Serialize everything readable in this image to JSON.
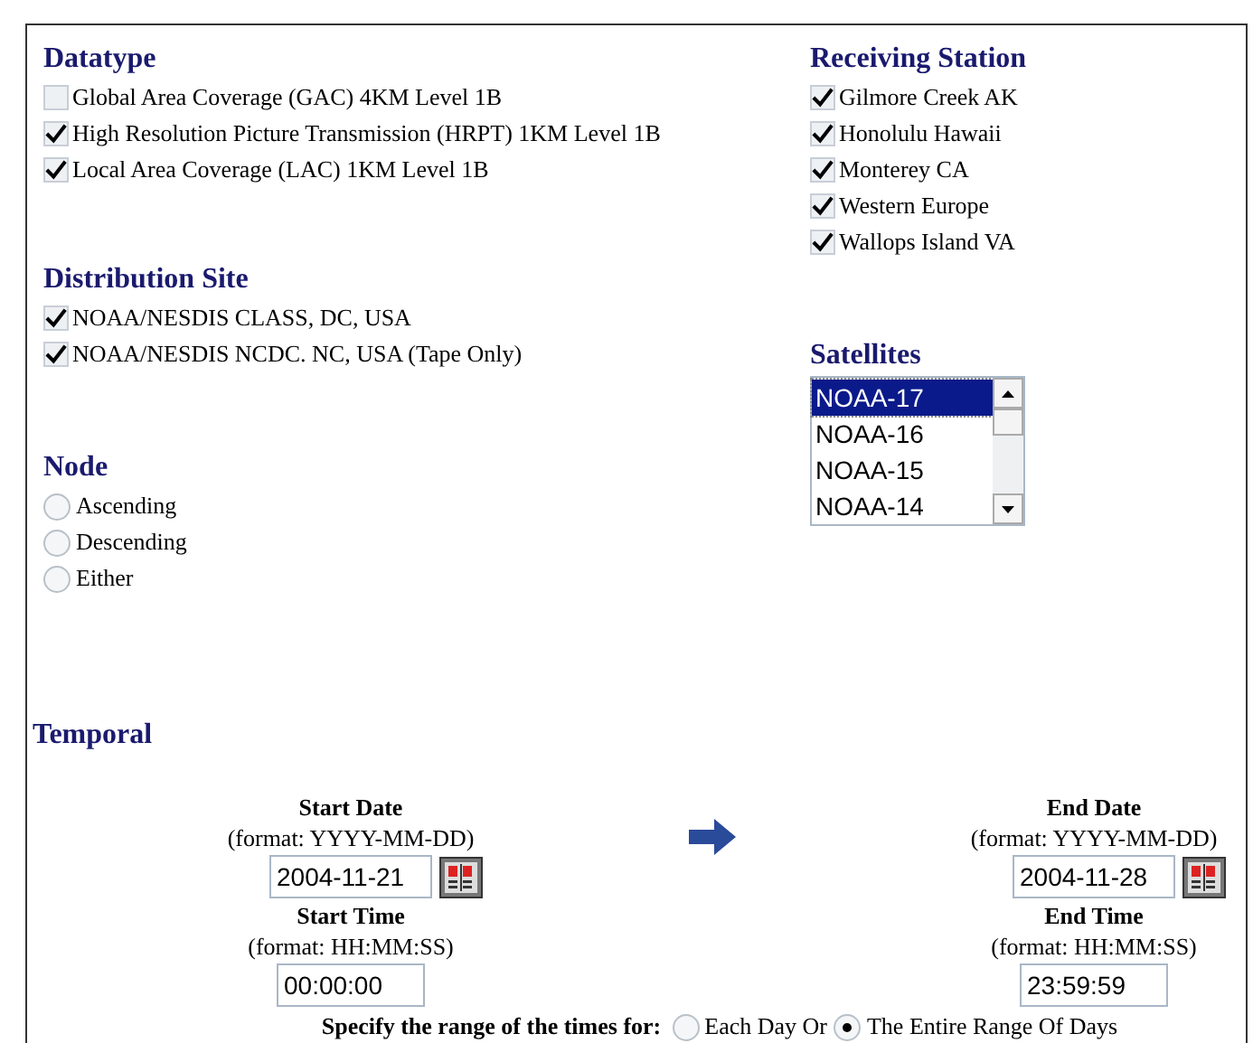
{
  "datatype": {
    "title": "Datatype",
    "options": [
      {
        "label": "Global Area Coverage (GAC) 4KM Level 1B",
        "checked": false
      },
      {
        "label": "High Resolution Picture Transmission (HRPT) 1KM Level 1B",
        "checked": true
      },
      {
        "label": "Local Area Coverage (LAC) 1KM Level 1B",
        "checked": true
      }
    ]
  },
  "distribution_site": {
    "title": "Distribution Site",
    "options": [
      {
        "label": "NOAA/NESDIS CLASS, DC, USA",
        "checked": true
      },
      {
        "label": "NOAA/NESDIS NCDC. NC, USA (Tape Only)",
        "checked": true
      }
    ]
  },
  "node": {
    "title": "Node",
    "options": [
      {
        "label": "Ascending",
        "selected": false
      },
      {
        "label": "Descending",
        "selected": false
      },
      {
        "label": "Either",
        "selected": false
      }
    ]
  },
  "receiving_station": {
    "title": "Receiving Station",
    "options": [
      {
        "label": "Gilmore Creek AK",
        "checked": true
      },
      {
        "label": "Honolulu Hawaii",
        "checked": true
      },
      {
        "label": "Monterey CA",
        "checked": true
      },
      {
        "label": "Western Europe",
        "checked": true
      },
      {
        "label": "Wallops Island VA",
        "checked": true
      }
    ]
  },
  "satellites": {
    "title": "Satellites",
    "items": [
      {
        "label": "NOAA-17",
        "selected": true
      },
      {
        "label": "NOAA-16",
        "selected": false
      },
      {
        "label": "NOAA-15",
        "selected": false
      },
      {
        "label": "NOAA-14",
        "selected": false
      }
    ]
  },
  "temporal": {
    "title": "Temporal",
    "start_date": {
      "label": "Start Date",
      "format": "(format: YYYY-MM-DD)",
      "value": "2004-11-21"
    },
    "start_time": {
      "label": "Start Time",
      "format": "(format: HH:MM:SS)",
      "value": "00:00:00"
    },
    "end_date": {
      "label": "End Date",
      "format": "(format: YYYY-MM-DD)",
      "value": "2004-11-28"
    },
    "end_time": {
      "label": "End Time",
      "format": "(format: HH:MM:SS)",
      "value": "23:59:59"
    },
    "range": {
      "label": "Specify the range of the times for:",
      "options": [
        {
          "label": "Each Day Or",
          "selected": false
        },
        {
          "label": "The Entire Range Of Days",
          "selected": true
        }
      ]
    }
  }
}
